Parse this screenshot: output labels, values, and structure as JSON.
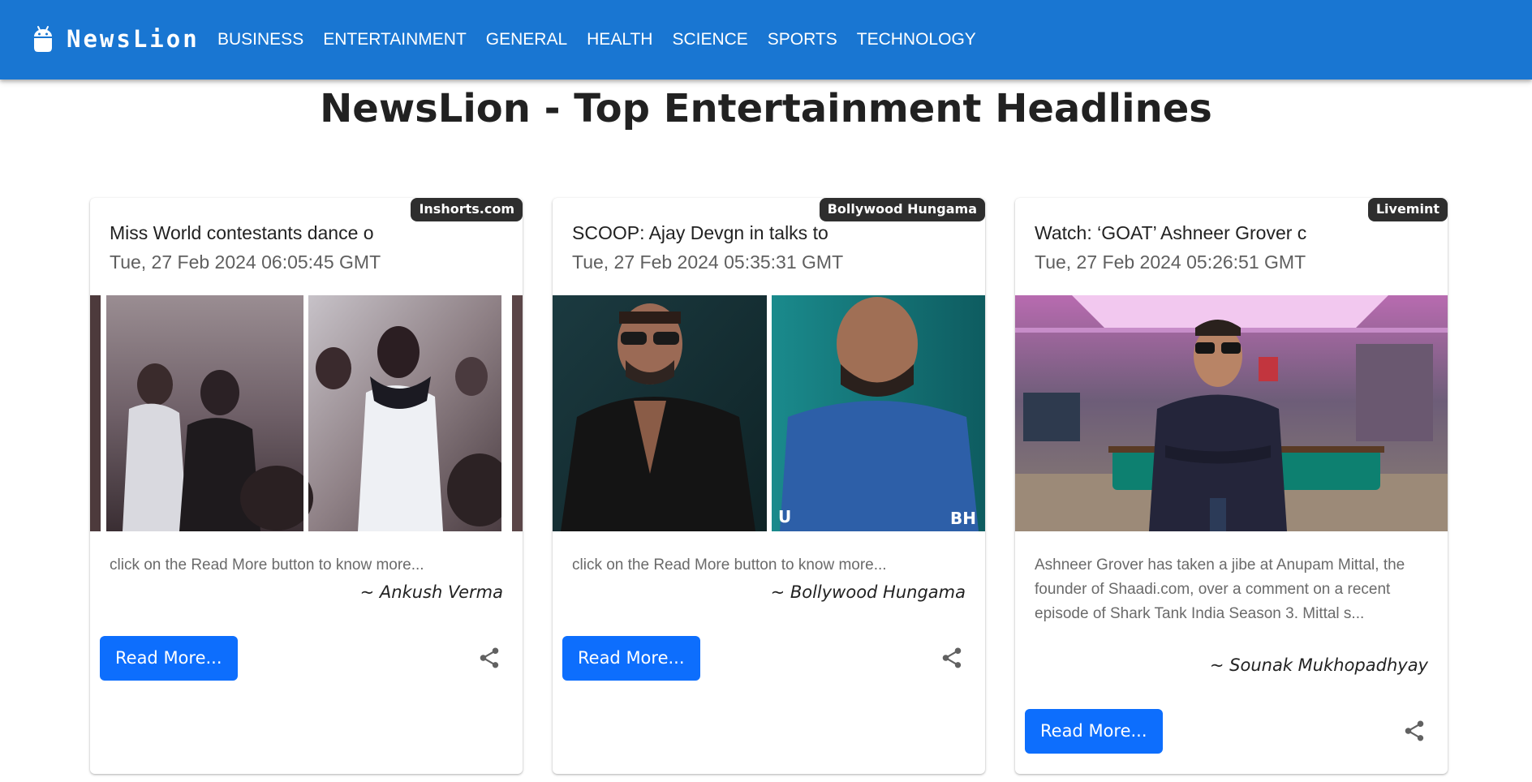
{
  "app": {
    "brand": "NewsLion",
    "icon": "android-icon",
    "colors": {
      "appbar": "#1976d2",
      "button": "#0d6efd",
      "badge": "#2e2e2e"
    }
  },
  "nav": {
    "links": [
      "BUSINESS",
      "ENTERTAINMENT",
      "GENERAL",
      "HEALTH",
      "SCIENCE",
      "SPORTS",
      "TECHNOLOGY"
    ]
  },
  "page": {
    "title": "NewsLion - Top Entertainment Headlines"
  },
  "cards": [
    {
      "source": "Inshorts.com",
      "title": "Miss World contestants dance o",
      "date": "Tue, 27 Feb 2024 06:05:45 GMT",
      "description": "click on the Read More button to know more...",
      "author": "~ Ankush Verma",
      "button": "Read More...",
      "share_icon": "share-icon"
    },
    {
      "source": "Bollywood Hungama",
      "title": "SCOOP: Ajay Devgn in talks to",
      "date": "Tue, 27 Feb 2024 05:35:31 GMT",
      "description": "click on the Read More button to know more...",
      "author": "~ Bollywood Hungama",
      "button": "Read More...",
      "share_icon": "share-icon"
    },
    {
      "source": "Livemint",
      "title": "Watch: ‘GOAT’ Ashneer Grover c",
      "date": "Tue, 27 Feb 2024 05:26:51 GMT",
      "description": "Ashneer Grover has taken a jibe at Anupam Mittal, the founder of Shaadi.com, over a comment on a recent episode of Shark Tank India Season 3. Mittal s...",
      "author": "~ Sounak Mukhopadhyay",
      "button": "Read More...",
      "share_icon": "share-icon"
    }
  ]
}
